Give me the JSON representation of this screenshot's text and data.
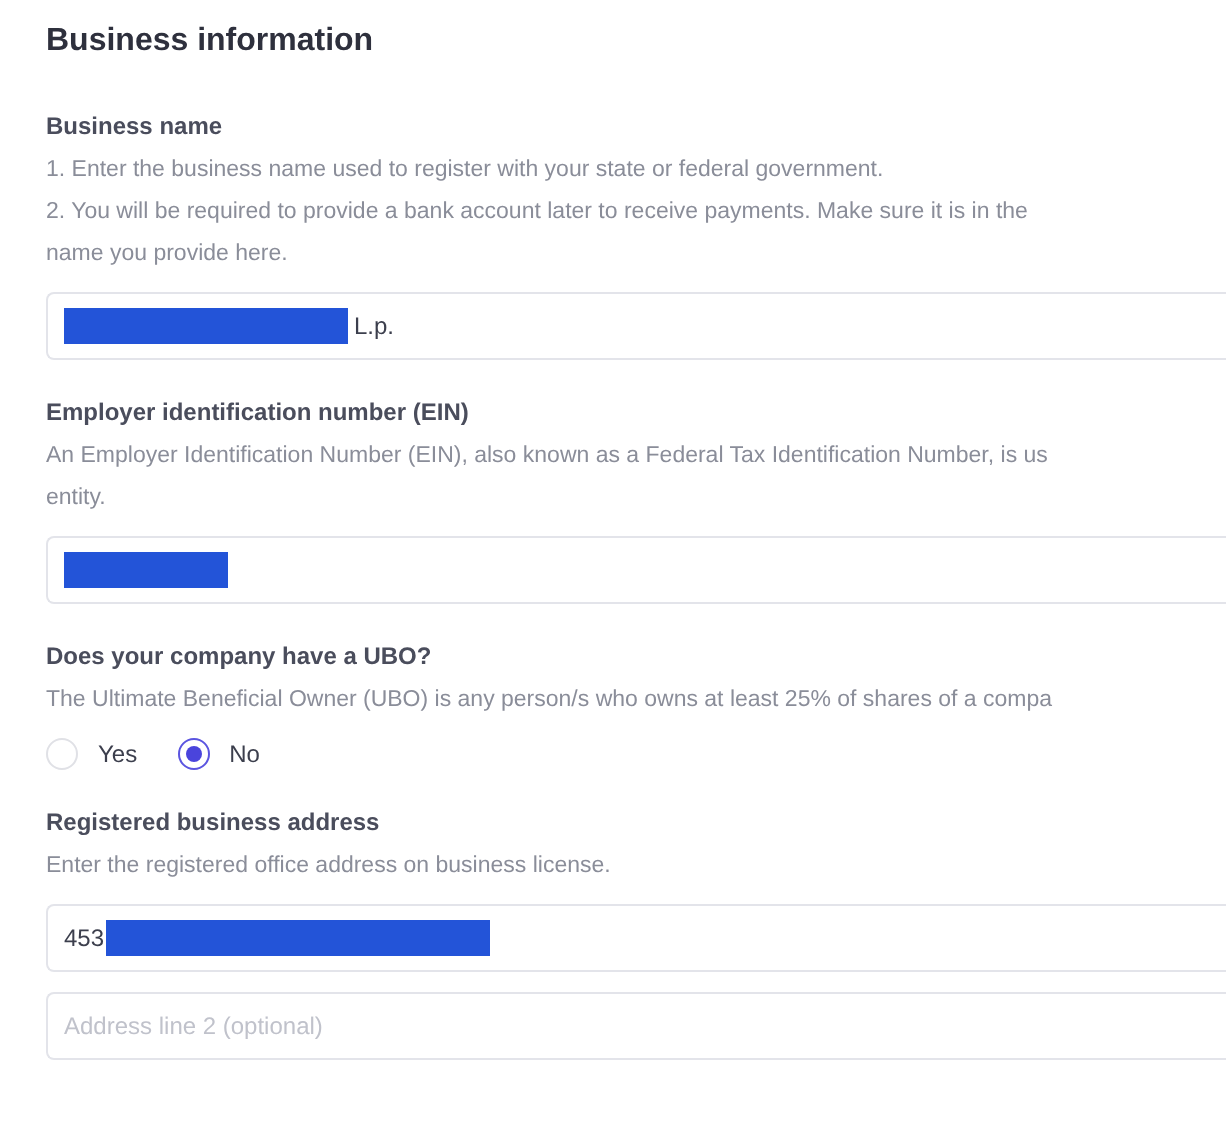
{
  "title": "Business information",
  "sections": [
    {
      "kind": "field",
      "label": "Business name",
      "description": [
        "1. Enter the business name used to register with your state or federal government.",
        "2. You will be required to provide a bank account later to receive payments. Make sure it is in the",
        "name you provide here."
      ],
      "inputs": [
        {
          "value": "L.p.",
          "kind": "masked-start"
        }
      ]
    },
    {
      "kind": "field",
      "label": "Employer identification number (EIN)",
      "description": [
        "An Employer Identification Number (EIN), also known as a Federal Tax Identification Number, is us",
        "entity."
      ],
      "inputs": [
        {
          "kind": "masked"
        }
      ]
    },
    {
      "kind": "radio",
      "label": "Does your company have a UBO?",
      "description": [
        "The Ultimate Beneficial Owner (UBO) is any person/s who owns at least 25% of shares of a compa"
      ],
      "options": [
        {
          "label": "Yes",
          "selected": false
        },
        {
          "label": "No",
          "selected": true
        }
      ]
    },
    {
      "kind": "field",
      "label": "Registered business address",
      "description": [
        "Enter the registered office address on business license."
      ],
      "inputs": [
        {
          "value": "453",
          "kind": "masked-end"
        },
        {
          "placeholder": "Address line 2 (optional)"
        }
      ]
    }
  ]
}
